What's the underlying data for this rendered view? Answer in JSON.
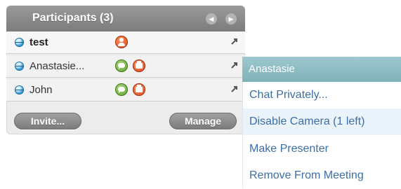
{
  "participants_panel": {
    "title": "Participants (3)",
    "nav_prev_icon": "chevron-left-icon",
    "nav_next_icon": "chevron-right-icon",
    "participants": [
      {
        "name": "test",
        "bold": true,
        "status_icon": "online-status-icon",
        "icons": [
          "presenter-icon"
        ],
        "action_icon": "pin-icon"
      },
      {
        "name": "Anastasie...",
        "bold": false,
        "status_icon": "online-status-icon",
        "icons": [
          "chat-icon",
          "camera-icon"
        ],
        "action_icon": "pin-icon"
      },
      {
        "name": "John",
        "bold": false,
        "status_icon": "online-status-icon",
        "icons": [
          "chat-icon",
          "camera-icon"
        ],
        "action_icon": "pin-icon"
      }
    ],
    "invite_label": "Invite...",
    "manage_label": "Manage"
  },
  "context_menu": {
    "title": "Anastasie",
    "items": [
      {
        "label": "Chat Privately..."
      },
      {
        "label": "Disable Camera (1 left)"
      },
      {
        "label": "Make Presenter"
      },
      {
        "label": "Remove From Meeting"
      }
    ]
  },
  "colors": {
    "panel_header": "#8a8a8a",
    "menu_header": "#8dbcc4",
    "menu_text": "#3b6ea5",
    "presenter_icon": "#e0521f",
    "chat_icon": "#6aa83a",
    "status_dot": "#2d8fc6"
  }
}
